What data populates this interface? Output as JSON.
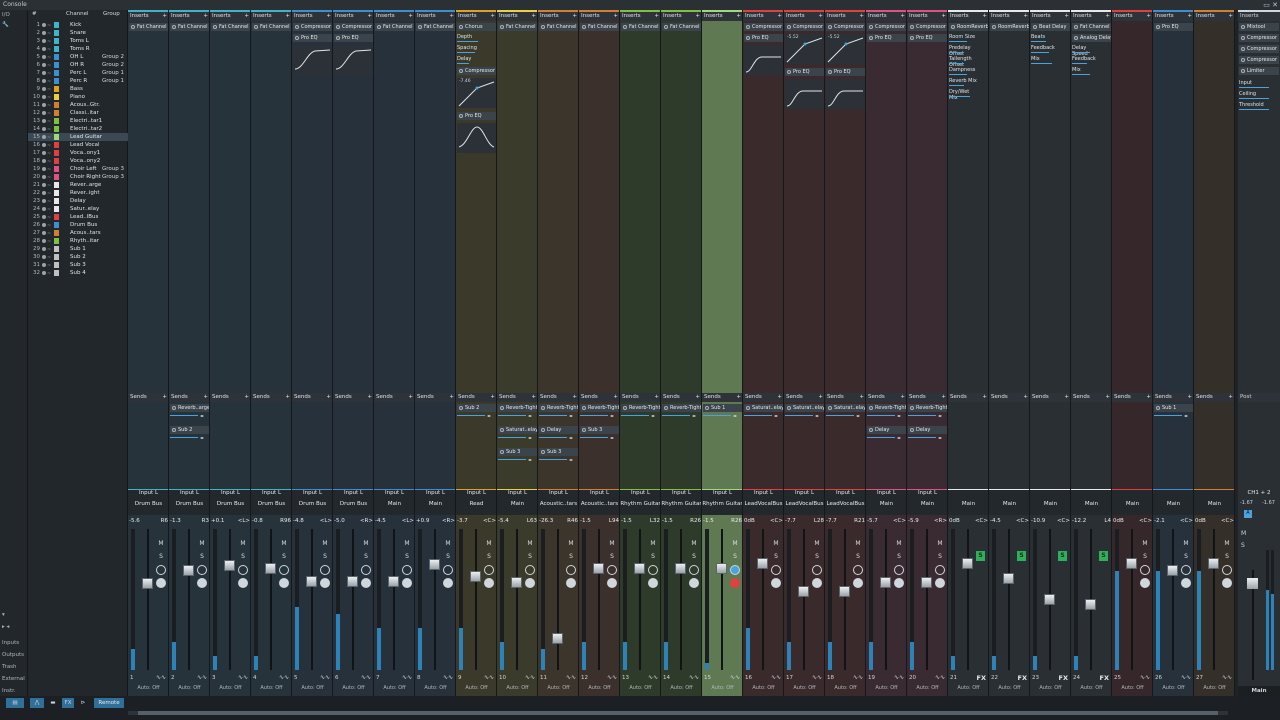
{
  "window": {
    "title": "Console"
  },
  "left": {
    "io_label": "I/O",
    "inputs": "Inputs",
    "outputs": "Outputs",
    "trash": "Trash",
    "external": "External",
    "instr": "Instr."
  },
  "list_headers": {
    "num": "#",
    "channel": "Channel",
    "group": "Group"
  },
  "channel_list": [
    {
      "n": "1",
      "name": "Kick",
      "group": "",
      "color": "#3fb4c8"
    },
    {
      "n": "2",
      "name": "Snare",
      "group": "",
      "color": "#3fb4c8"
    },
    {
      "n": "3",
      "name": "Toms L",
      "group": "",
      "color": "#3fb4c8"
    },
    {
      "n": "4",
      "name": "Toms R",
      "group": "",
      "color": "#3fb4c8"
    },
    {
      "n": "5",
      "name": "OH L",
      "group": "Group 2",
      "color": "#3f8fd0"
    },
    {
      "n": "6",
      "name": "OH R",
      "group": "Group 2",
      "color": "#3f8fd0"
    },
    {
      "n": "7",
      "name": "Perc L",
      "group": "Group 1",
      "color": "#3f8fd0"
    },
    {
      "n": "8",
      "name": "Perc R",
      "group": "Group 1",
      "color": "#3f8fd0"
    },
    {
      "n": "9",
      "name": "Bass",
      "group": "",
      "color": "#e0a020"
    },
    {
      "n": "10",
      "name": "Piano",
      "group": "",
      "color": "#e8d040"
    },
    {
      "n": "11",
      "name": "Acous..Gtr.",
      "group": "",
      "color": "#d08030"
    },
    {
      "n": "12",
      "name": "Classi..itar",
      "group": "",
      "color": "#d08030"
    },
    {
      "n": "13",
      "name": "Electri..tar1",
      "group": "",
      "color": "#80c040"
    },
    {
      "n": "14",
      "name": "Electri..tar2",
      "group": "",
      "color": "#80c040"
    },
    {
      "n": "15",
      "name": "Lead Guitar",
      "group": "",
      "color": "#a0d880"
    },
    {
      "n": "16",
      "name": "Lead Vocal",
      "group": "",
      "color": "#e04040"
    },
    {
      "n": "17",
      "name": "Voca..ony1",
      "group": "",
      "color": "#e04040"
    },
    {
      "n": "18",
      "name": "Voca..ony2",
      "group": "",
      "color": "#e04040"
    },
    {
      "n": "19",
      "name": "Choir Left",
      "group": "Group 3",
      "color": "#e05080"
    },
    {
      "n": "20",
      "name": "Choir Right",
      "group": "Group 3",
      "color": "#e05080"
    },
    {
      "n": "21",
      "name": "Rever..arge",
      "group": "",
      "color": "#e8e8e8"
    },
    {
      "n": "22",
      "name": "Rever..ight",
      "group": "",
      "color": "#e8e8e8"
    },
    {
      "n": "23",
      "name": "Delay",
      "group": "",
      "color": "#e8e8e8"
    },
    {
      "n": "24",
      "name": "Satur..elay",
      "group": "",
      "color": "#e8e8e8"
    },
    {
      "n": "25",
      "name": "Lead..lBus",
      "group": "",
      "color": "#e04040"
    },
    {
      "n": "26",
      "name": "Drum Bus",
      "group": "",
      "color": "#3f8fd0"
    },
    {
      "n": "27",
      "name": "Acous..tars",
      "group": "",
      "color": "#d08030"
    },
    {
      "n": "28",
      "name": "Rhyth..itar",
      "group": "",
      "color": "#80c040"
    },
    {
      "n": "29",
      "name": "Sub 1",
      "group": "",
      "color": "#c0c0c0"
    },
    {
      "n": "30",
      "name": "Sub 2",
      "group": "",
      "color": "#c0c0c0"
    },
    {
      "n": "31",
      "name": "Sub 3",
      "group": "",
      "color": "#c0c0c0"
    },
    {
      "n": "32",
      "name": "Sub 4",
      "group": "",
      "color": "#c0c0c0"
    }
  ],
  "selected_channel": "15",
  "labels": {
    "inserts": "Inserts",
    "sends": "Sends",
    "post": "Post",
    "auto_off": "Auto: Off",
    "fx": "FX",
    "m": "M",
    "s": "S"
  },
  "strips": [
    {
      "idx": "1",
      "name": "Kick",
      "in": "Input L",
      "out": "Drum Bus",
      "vol": "-5.6",
      "pan": "R6",
      "color": "#3fb4c8",
      "bg": "#26333a",
      "fader": 0.62,
      "meter": 0.15,
      "inserts": [
        {
          "t": "plug",
          "name": "Fat Channel"
        }
      ],
      "sends": []
    },
    {
      "idx": "2",
      "name": "Snare",
      "in": "Input L",
      "out": "Drum Bus",
      "vol": "-1.3",
      "pan": "R3",
      "color": "#3fb4c8",
      "bg": "#26333a",
      "fader": 0.72,
      "meter": 0.2,
      "inserts": [
        {
          "t": "plug",
          "name": "Fat Channel"
        }
      ],
      "sends": [
        {
          "name": "Reverb..arge"
        },
        {
          "name": "Sub 2"
        }
      ]
    },
    {
      "idx": "3",
      "name": "Toms L",
      "in": "Input L",
      "out": "Drum Bus",
      "vol": "+0.1",
      "pan": "<L>",
      "color": "#3fb4c8",
      "bg": "#26333a",
      "fader": 0.76,
      "meter": 0.1,
      "inserts": [
        {
          "t": "plug",
          "name": "Fat Channel"
        }
      ],
      "sends": []
    },
    {
      "idx": "4",
      "name": "Toms R",
      "in": "Input L",
      "out": "Drum Bus",
      "vol": "-0.8",
      "pan": "R96",
      "color": "#3fb4c8",
      "bg": "#26333a",
      "fader": 0.74,
      "meter": 0.1,
      "inserts": [
        {
          "t": "plug",
          "name": "Fat Channel"
        }
      ],
      "sends": []
    },
    {
      "idx": "5",
      "name": "OH L",
      "in": "Input L",
      "out": "Drum Bus",
      "vol": "-4.8",
      "pan": "<L>",
      "color": "#3f8fd0",
      "bg": "#26313c",
      "fader": 0.64,
      "meter": 0.45,
      "inserts": [
        {
          "t": "plug",
          "name": "Compressor"
        },
        {
          "t": "plug",
          "name": "Pro EQ"
        },
        {
          "t": "eq"
        }
      ],
      "sends": []
    },
    {
      "idx": "6",
      "name": "OH R",
      "in": "Input L",
      "out": "Drum Bus",
      "vol": "-5.0",
      "pan": "<R>",
      "color": "#3f8fd0",
      "bg": "#26313c",
      "fader": 0.64,
      "meter": 0.4,
      "inserts": [
        {
          "t": "plug",
          "name": "Compressor"
        },
        {
          "t": "plug",
          "name": "Pro EQ"
        },
        {
          "t": "eq"
        }
      ],
      "sends": []
    },
    {
      "idx": "7",
      "name": "Perc L",
      "in": "Input L",
      "out": "Main",
      "vol": "-4.5",
      "pan": "<L>",
      "color": "#3f8fd0",
      "bg": "#26313c",
      "fader": 0.64,
      "meter": 0.3,
      "inserts": [
        {
          "t": "plug",
          "name": "Fat Channel"
        }
      ],
      "sends": []
    },
    {
      "idx": "8",
      "name": "Perc R",
      "in": "Input L",
      "out": "Main",
      "vol": "+0.9",
      "pan": "<R>",
      "color": "#3f8fd0",
      "bg": "#26313c",
      "fader": 0.77,
      "meter": 0.3,
      "inserts": [
        {
          "t": "plug",
          "name": "Fat Channel"
        }
      ],
      "sends": []
    },
    {
      "idx": "9",
      "name": "Bass",
      "in": "Input L",
      "out": "Read",
      "vol": "-3.7",
      "pan": "<C>",
      "color": "#e0a020",
      "bg": "#3b3a2a",
      "fader": 0.68,
      "meter": 0.3,
      "inserts": [
        {
          "t": "plug",
          "name": "Chorus"
        },
        {
          "t": "param",
          "name": "Depth",
          "v": 0.7
        },
        {
          "t": "param",
          "name": "Spacing",
          "v": 0.6
        },
        {
          "t": "param",
          "name": "Delay",
          "v": 0.4
        },
        {
          "t": "plug",
          "name": "Compressor"
        },
        {
          "t": "comp",
          "val": "-7.46"
        },
        {
          "t": "plug",
          "name": "Pro EQ"
        },
        {
          "t": "bell"
        }
      ],
      "sends": [
        {
          "name": "Sub 2"
        }
      ]
    },
    {
      "idx": "10",
      "name": "Piano",
      "in": "Input L",
      "out": "Main",
      "vol": "-5.4",
      "pan": "L63",
      "color": "#e8d040",
      "bg": "#3a3b2a",
      "fader": 0.63,
      "meter": 0.2,
      "inserts": [
        {
          "t": "plug",
          "name": "Fat Channel"
        }
      ],
      "sends": [
        {
          "name": "Reverb-Tight"
        },
        {
          "name": "Saturat..elay"
        },
        {
          "name": "Sub 3"
        }
      ]
    },
    {
      "idx": "11",
      "name": "Acoustic Gtr.",
      "in": "Input L",
      "out": "Acoustic..tars",
      "vol": "-26.3",
      "pan": "R46",
      "color": "#d08030",
      "bg": "#3b352c",
      "fader": 0.2,
      "meter": 0.15,
      "inserts": [
        {
          "t": "plug",
          "name": "Fat Channel"
        }
      ],
      "sends": [
        {
          "name": "Reverb-Tight"
        },
        {
          "name": "Delay"
        },
        {
          "name": "Sub 3"
        }
      ]
    },
    {
      "idx": "12",
      "name": "ClassicalGuitar",
      "in": "Input L",
      "out": "Acoustic..tars",
      "vol": "-1.5",
      "pan": "L94",
      "color": "#d08030",
      "bg": "#3b302c",
      "fader": 0.74,
      "meter": 0.2,
      "inserts": [
        {
          "t": "plug",
          "name": "Fat Channel"
        }
      ],
      "sends": [
        {
          "name": "Reverb-Tight"
        },
        {
          "name": "Sub 3"
        }
      ]
    },
    {
      "idx": "13",
      "name": "ElectricGuitar1",
      "in": "Input L",
      "out": "Rhythm Guitar",
      "vol": "-1.5",
      "pan": "L32",
      "color": "#80c040",
      "bg": "#2e3a2a",
      "fader": 0.74,
      "meter": 0.2,
      "inserts": [
        {
          "t": "plug",
          "name": "Fat Channel"
        }
      ],
      "sends": [
        {
          "name": "Reverb-Tight"
        }
      ]
    },
    {
      "idx": "14",
      "name": "ElectricGuitar2",
      "in": "Input L",
      "out": "Rhythm Guitar",
      "vol": "-1.5",
      "pan": "R26",
      "color": "#80c040",
      "bg": "#2e3a2a",
      "fader": 0.74,
      "meter": 0.2,
      "inserts": [
        {
          "t": "plug",
          "name": "Fat Channel"
        }
      ],
      "sends": [
        {
          "name": "Reverb-Tight"
        }
      ]
    },
    {
      "idx": "15",
      "name": "Lead Guitar",
      "in": "Input L",
      "out": "Rhythm Guitar",
      "vol": "-1.5",
      "pan": "R26",
      "color": "#a0d880",
      "bg": "#5f7a52",
      "fader": 0.74,
      "meter": 0.05,
      "selected": true,
      "rec": true,
      "inserts": [],
      "sends": [
        {
          "name": "Sub 1"
        }
      ]
    },
    {
      "idx": "16",
      "name": "Lead Vocal",
      "in": "Input L",
      "out": "LeadVocalBus",
      "vol": "0dB",
      "pan": "<C>",
      "color": "#e04040",
      "bg": "#3a2a2c",
      "fader": 0.78,
      "meter": 0.3,
      "inserts": [
        {
          "t": "plug",
          "name": "Compressor"
        },
        {
          "t": "plug",
          "name": "Pro EQ"
        },
        {
          "t": "hp"
        }
      ],
      "sends": [
        {
          "name": "Saturat..elay"
        }
      ]
    },
    {
      "idx": "17",
      "name": "VocalHar..ony1",
      "in": "Input L",
      "out": "LeadVocalBus",
      "vol": "-7.7",
      "pan": "L28",
      "color": "#e04040",
      "bg": "#3a2a2c",
      "fader": 0.56,
      "meter": 0.2,
      "inserts": [
        {
          "t": "plug",
          "name": "Compressor"
        },
        {
          "t": "comp",
          "val": "-5.52"
        },
        {
          "t": "plug",
          "name": "Pro EQ"
        },
        {
          "t": "hp"
        }
      ],
      "sends": [
        {
          "name": "Saturat..elay"
        }
      ]
    },
    {
      "idx": "18",
      "name": "VocalHar..ony2",
      "in": "Input L",
      "out": "LeadVocalBus",
      "vol": "-7.7",
      "pan": "R21",
      "color": "#e04040",
      "bg": "#3a2a2c",
      "fader": 0.56,
      "meter": 0.2,
      "inserts": [
        {
          "t": "plug",
          "name": "Compressor"
        },
        {
          "t": "comp",
          "val": "-5.52"
        },
        {
          "t": "plug",
          "name": "Pro EQ"
        },
        {
          "t": "hp"
        }
      ],
      "sends": [
        {
          "name": "Saturat..elay"
        }
      ]
    },
    {
      "idx": "19",
      "name": "Choir Left",
      "in": "Input L",
      "out": "Main",
      "vol": "-5.7",
      "pan": "<C>",
      "color": "#e05080",
      "bg": "#3a2a32",
      "fader": 0.63,
      "meter": 0.2,
      "inserts": [
        {
          "t": "plug",
          "name": "Compressor"
        },
        {
          "t": "plug",
          "name": "Pro EQ"
        }
      ],
      "sends": [
        {
          "name": "Reverb-Tight"
        },
        {
          "name": "Delay"
        }
      ]
    },
    {
      "idx": "20",
      "name": "Choir Right",
      "in": "Input L",
      "out": "Main",
      "vol": "-5.9",
      "pan": "<R>",
      "color": "#e05080",
      "bg": "#3a2a32",
      "fader": 0.63,
      "meter": 0.2,
      "inserts": [
        {
          "t": "plug",
          "name": "Compressor"
        },
        {
          "t": "plug",
          "name": "Pro EQ"
        }
      ],
      "sends": [
        {
          "name": "Reverb-Tight"
        },
        {
          "name": "Delay"
        }
      ]
    },
    {
      "idx": "21",
      "name": "Reverb - Large",
      "in": "",
      "out": "Main",
      "vol": "0dB",
      "pan": "<C>",
      "color": "#e8e8e8",
      "bg": "#2a2f33",
      "fader": 0.78,
      "meter": 0.1,
      "fxch": true,
      "inserts": [
        {
          "t": "plug",
          "name": "RoomReverb"
        },
        {
          "t": "param",
          "name": "Room Size",
          "v": 0.6
        },
        {
          "t": "param",
          "name": "Predelay Offset",
          "v": 0.5
        },
        {
          "t": "param",
          "name": "Tailength Offset",
          "v": 0.5
        },
        {
          "t": "param",
          "name": "Dampness",
          "v": 0.6
        },
        {
          "t": "param",
          "name": "Reverb Mix",
          "v": 0.5
        },
        {
          "t": "param",
          "name": "Dry/Wet Mix",
          "v": 0.7
        }
      ],
      "sends": []
    },
    {
      "idx": "22",
      "name": "Reverb - Tight",
      "in": "",
      "out": "Main",
      "vol": "-4.5",
      "pan": "<C>",
      "color": "#e8e8e8",
      "bg": "#2a2f33",
      "fader": 0.66,
      "meter": 0.1,
      "fxch": true,
      "inserts": [
        {
          "t": "plug",
          "name": "RoomReverb"
        }
      ],
      "sends": []
    },
    {
      "idx": "23",
      "name": "Delay",
      "in": "",
      "out": "Main",
      "vol": "-10.9",
      "pan": "<C>",
      "color": "#e8e8e8",
      "bg": "#2a2f33",
      "fader": 0.5,
      "meter": 0.1,
      "fxch": true,
      "inserts": [
        {
          "t": "plug",
          "name": "Beat Delay"
        },
        {
          "t": "param",
          "name": "Beats",
          "v": 0.5
        },
        {
          "t": "param",
          "name": "Feedback",
          "v": 0.6
        },
        {
          "t": "param",
          "name": "Mix",
          "v": 0.7
        }
      ],
      "sends": []
    },
    {
      "idx": "24",
      "name": "SaturatedDelay",
      "in": "",
      "out": "Main",
      "vol": "-12.2",
      "pan": "L4",
      "color": "#e8e8e8",
      "bg": "#2a2f33",
      "fader": 0.46,
      "meter": 0.1,
      "fxch": true,
      "inserts": [
        {
          "t": "plug",
          "name": "Fat Channel"
        },
        {
          "t": "plug",
          "name": "Analog Delay"
        },
        {
          "t": "param",
          "name": "Delay Speed",
          "v": 0.6
        },
        {
          "t": "param",
          "name": "Feedback",
          "v": 0.5
        },
        {
          "t": "param",
          "name": "Mix",
          "v": 0.6
        }
      ],
      "sends": []
    },
    {
      "idx": "25",
      "name": "Lead Vocal Bus",
      "in": "",
      "out": "Main",
      "vol": "0dB",
      "pan": "<C>",
      "color": "#e04040",
      "bg": "#35272a",
      "fader": 0.78,
      "meter": 0.7,
      "inserts": [],
      "sends": []
    },
    {
      "idx": "26",
      "name": "Drum Bus",
      "in": "",
      "out": "Main",
      "vol": "-2.1",
      "pan": "<C>",
      "color": "#3f8fd0",
      "bg": "#26313c",
      "fader": 0.72,
      "meter": 0.7,
      "inserts": [
        {
          "t": "plug",
          "name": "Pro EQ"
        }
      ],
      "sends": [
        {
          "name": "Sub 1"
        }
      ]
    },
    {
      "idx": "27",
      "name": "AcousticG..tars",
      "in": "",
      "out": "Main",
      "vol": "0dB",
      "pan": "<C>",
      "color": "#d08030",
      "bg": "#352f2a",
      "fader": 0.78,
      "meter": 0.7,
      "inserts": [],
      "sends": []
    }
  ],
  "main": {
    "name": "Main",
    "out": "CH1 + 2",
    "vol_l": "-1.67",
    "vol_r": "-1.67",
    "inserts": [
      "Mixtool",
      "Compressor",
      "Compressor",
      "Compressor",
      "Limiter"
    ],
    "params": [
      "Input",
      "Ceiling",
      "Threshold"
    ]
  },
  "bottom": {
    "remote": "Remote",
    "fx": "FX"
  }
}
